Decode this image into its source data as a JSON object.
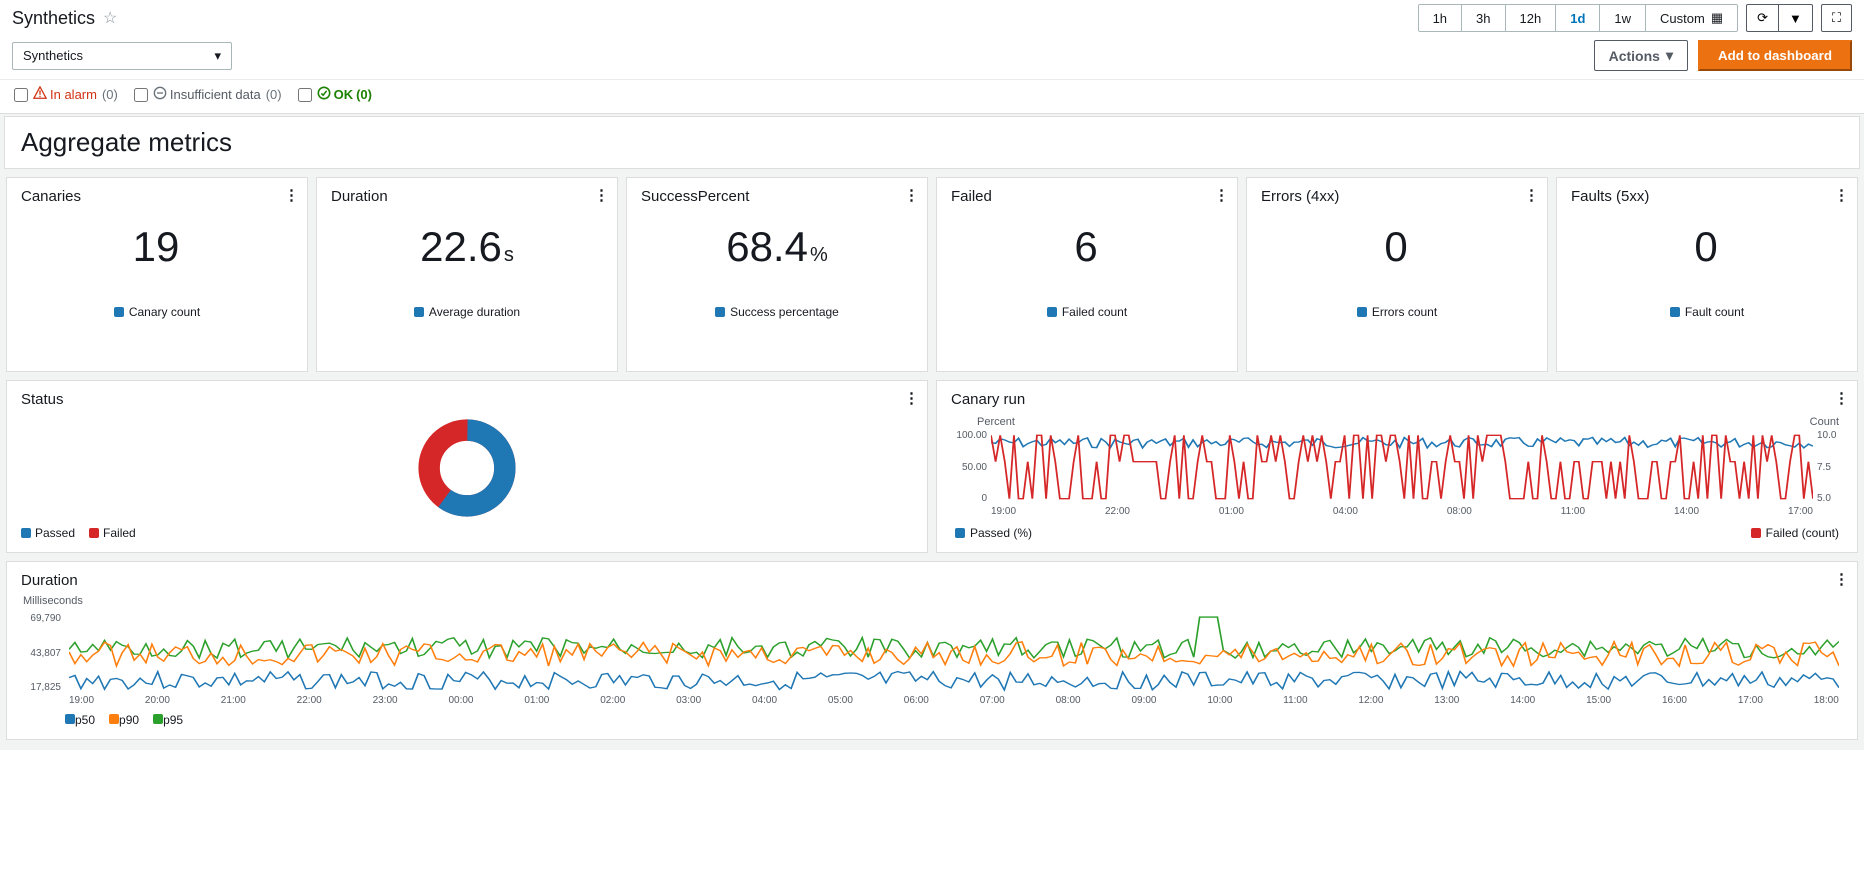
{
  "page_title": "Synthetics",
  "time_ranges": [
    "1h",
    "3h",
    "12h",
    "1d",
    "1w"
  ],
  "time_range_active": "1d",
  "custom_label": "Custom",
  "actions_label": "Actions",
  "add_dashboard_label": "Add to dashboard",
  "namespace_selected": "Synthetics",
  "alarm_filters": {
    "in_alarm": {
      "label": "In alarm",
      "count": "(0)"
    },
    "insufficient": {
      "label": "Insufficient data",
      "count": "(0)"
    },
    "ok": {
      "label": "OK",
      "count": "(0)"
    }
  },
  "section_title": "Aggregate metrics",
  "metrics": [
    {
      "title": "Canaries",
      "value": "19",
      "unit": "",
      "legend": "Canary count"
    },
    {
      "title": "Duration",
      "value": "22.6",
      "unit": "s",
      "legend": "Average duration"
    },
    {
      "title": "SuccessPercent",
      "value": "68.4",
      "unit": "%",
      "legend": "Success percentage"
    },
    {
      "title": "Failed",
      "value": "6",
      "unit": "",
      "legend": "Failed count"
    },
    {
      "title": "Errors (4xx)",
      "value": "0",
      "unit": "",
      "legend": "Errors count"
    },
    {
      "title": "Faults (5xx)",
      "value": "0",
      "unit": "",
      "legend": "Fault count"
    }
  ],
  "status_widget": {
    "title": "Status",
    "legend": [
      {
        "label": "Passed",
        "color": "#1f77b4"
      },
      {
        "label": "Failed",
        "color": "#d62728"
      }
    ]
  },
  "canary_run": {
    "title": "Canary run",
    "left_axis_label": "Percent",
    "right_axis_label": "Count",
    "left_ticks": [
      "100.00",
      "50.00",
      "0"
    ],
    "right_ticks": [
      "10.0",
      "7.5",
      "5.0"
    ],
    "x_ticks": [
      "19:00",
      "22:00",
      "01:00",
      "04:00",
      "08:00",
      "11:00",
      "14:00",
      "17:00"
    ],
    "legend_left": "Passed (%)",
    "legend_right": "Failed (count)"
  },
  "duration_widget": {
    "title": "Duration",
    "ylabel": "Milliseconds",
    "y_ticks": [
      "69,790",
      "43,807",
      "17,825"
    ],
    "x_ticks": [
      "19:00",
      "20:00",
      "21:00",
      "22:00",
      "23:00",
      "00:00",
      "01:00",
      "02:00",
      "03:00",
      "04:00",
      "05:00",
      "06:00",
      "07:00",
      "08:00",
      "09:00",
      "10:00",
      "11:00",
      "12:00",
      "13:00",
      "14:00",
      "15:00",
      "16:00",
      "17:00",
      "18:00"
    ],
    "legend": [
      {
        "label": "p50",
        "color": "#1f77b4"
      },
      {
        "label": "p90",
        "color": "#ff7f0e"
      },
      {
        "label": "p95",
        "color": "#2ca02c"
      }
    ]
  },
  "chart_data": [
    {
      "type": "pie",
      "title": "Status",
      "series": [
        {
          "name": "Passed",
          "value": 60
        },
        {
          "name": "Failed",
          "value": 40
        }
      ]
    },
    {
      "type": "line",
      "title": "Canary run",
      "x_ticks": [
        "19:00",
        "22:00",
        "01:00",
        "04:00",
        "08:00",
        "11:00",
        "14:00",
        "17:00"
      ],
      "left_axis": {
        "label": "Percent",
        "range": [
          0,
          100
        ]
      },
      "right_axis": {
        "label": "Count",
        "range": [
          5,
          10
        ]
      },
      "series": [
        {
          "name": "Passed (%)",
          "axis": "left",
          "approx_range": [
            40,
            90
          ]
        },
        {
          "name": "Failed (count)",
          "axis": "right",
          "approx_range": [
            5,
            10
          ]
        }
      ]
    },
    {
      "type": "line",
      "title": "Duration",
      "ylabel": "Milliseconds",
      "ylim": [
        17825,
        69790
      ],
      "x_ticks": [
        "19:00",
        "20:00",
        "21:00",
        "22:00",
        "23:00",
        "00:00",
        "01:00",
        "02:00",
        "03:00",
        "04:00",
        "05:00",
        "06:00",
        "07:00",
        "08:00",
        "09:00",
        "10:00",
        "11:00",
        "12:00",
        "13:00",
        "14:00",
        "15:00",
        "16:00",
        "17:00",
        "18:00"
      ],
      "series": [
        {
          "name": "p50",
          "approx_mean": 20000
        },
        {
          "name": "p90",
          "approx_mean": 40000
        },
        {
          "name": "p95",
          "approx_mean": 45000
        }
      ]
    }
  ]
}
